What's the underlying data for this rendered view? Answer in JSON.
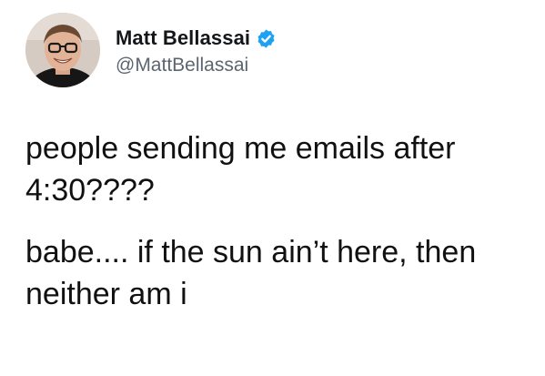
{
  "author": {
    "display_name": "Matt Bellassai",
    "handle": "@MattBellassai",
    "verified": true,
    "avatar_icon": "profile-photo",
    "verified_icon": "verified-badge-icon",
    "verified_color": "#1da1f2"
  },
  "tweet": {
    "paragraph_1_line_1": "people sending me emails after",
    "paragraph_1_line_2": "4:30????",
    "paragraph_2_line_1": "babe.... if the sun ain’t here, then",
    "paragraph_2_line_2": "neither am i"
  }
}
